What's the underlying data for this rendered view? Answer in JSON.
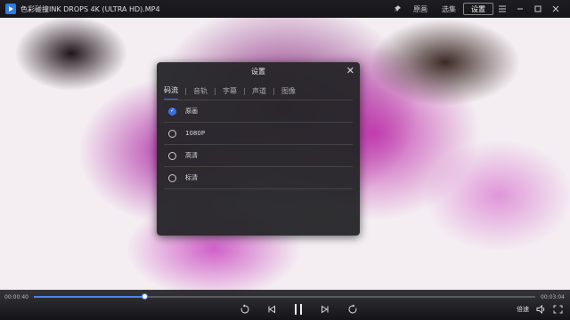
{
  "window": {
    "title": "色彩碰撞INK DROPS 4K (ULTRA HD).MP4",
    "buttons": {
      "playlist": "原画",
      "episodes": "选集",
      "settings": "设置"
    }
  },
  "dialog": {
    "title": "设置",
    "tabs": [
      {
        "label": "码流",
        "active": true
      },
      {
        "label": "音轨",
        "active": false
      },
      {
        "label": "字幕",
        "active": false
      },
      {
        "label": "声道",
        "active": false
      },
      {
        "label": "图像",
        "active": false
      }
    ],
    "options": [
      {
        "label": "原画",
        "selected": true
      },
      {
        "label": "1080P",
        "selected": false
      },
      {
        "label": "高清",
        "selected": false
      },
      {
        "label": "标清",
        "selected": false
      }
    ]
  },
  "player": {
    "elapsed": "00:00:40",
    "total": "00:03:04",
    "progress": 0.22,
    "speed_label": "倍速"
  },
  "colors": {
    "accent": "#3a6fe0",
    "progress": "#4a86f0"
  }
}
